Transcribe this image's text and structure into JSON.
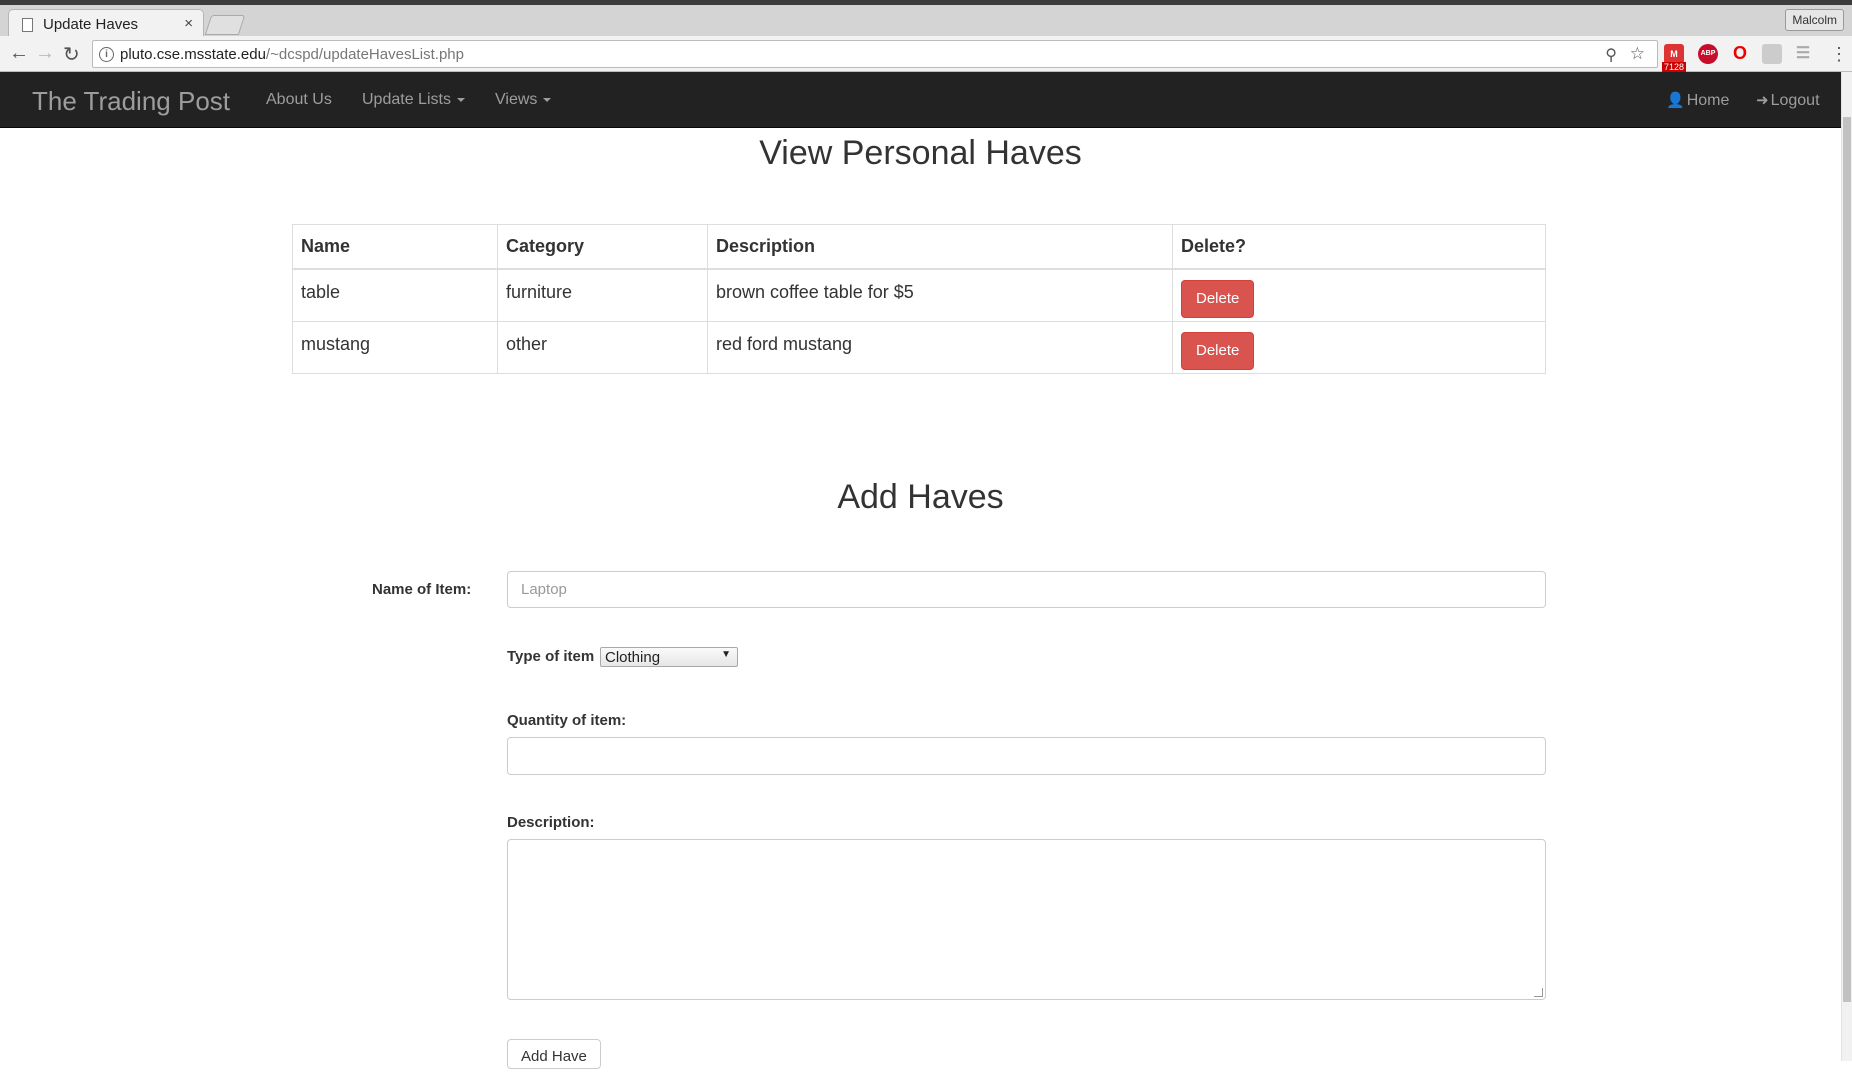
{
  "browser": {
    "tab_title": "Update Haves",
    "tab_close": "×",
    "profile_name": "Malcolm",
    "url_host": "pluto.cse.msstate.edu",
    "url_path": "/~dcspd/updateHavesList.php",
    "gmail_badge": "7128",
    "icons": [
      "back-arrow-icon",
      "forward-arrow-icon",
      "reload-icon",
      "info-icon",
      "zoom-icon",
      "bookmark-star-icon",
      "gmail-icon",
      "adblock-icon",
      "opera-icon",
      "extension-icon",
      "reader-icon",
      "chrome-menu-icon"
    ]
  },
  "navbar": {
    "brand": "The Trading Post",
    "about": "About Us",
    "update_lists": "Update Lists",
    "views": "Views",
    "home": "Home",
    "logout": "Logout"
  },
  "view_section": {
    "title": "View Personal Haves",
    "headers": [
      "Name",
      "Category",
      "Description",
      "Delete?"
    ],
    "rows": [
      {
        "name": "table",
        "category": "furniture",
        "description": "brown coffee table for $5",
        "action": "Delete"
      },
      {
        "name": "mustang",
        "category": "other",
        "description": "red ford mustang",
        "action": "Delete"
      }
    ]
  },
  "add_section": {
    "title": "Add Haves",
    "name_label": "Name of Item:",
    "name_placeholder": "Laptop",
    "type_label": "Type of item",
    "type_selected": "Clothing",
    "quantity_label": "Quantity of item:",
    "quantity_value": "",
    "description_label": "Description:",
    "description_value": "",
    "submit_label": "Add Have"
  },
  "colors": {
    "navbar_bg": "#222222",
    "delete_button": "#d9534f"
  }
}
